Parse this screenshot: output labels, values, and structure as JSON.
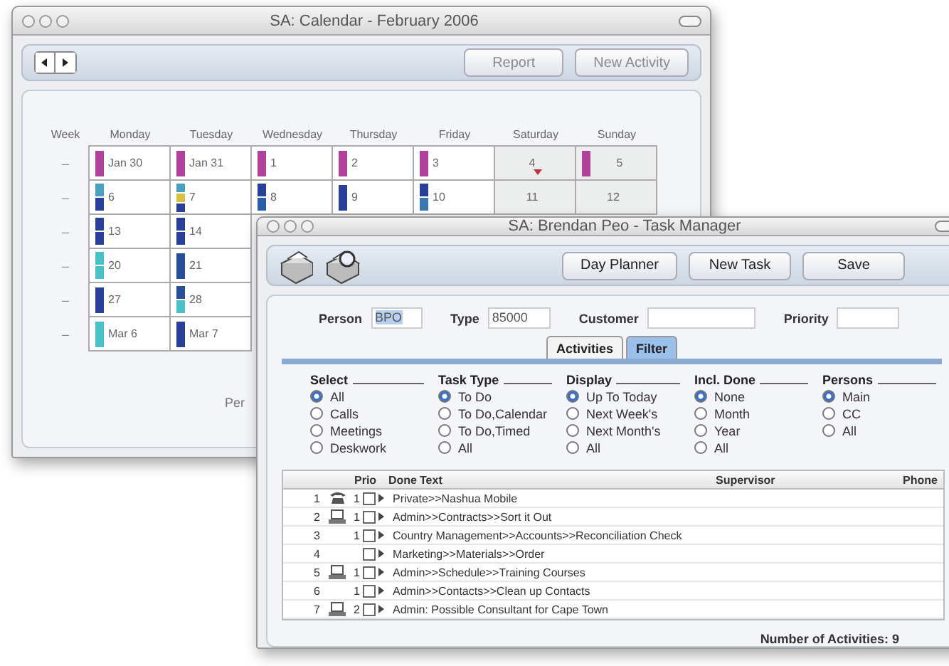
{
  "calendar": {
    "title": "SA: Calendar - February 2006",
    "buttons": [
      {
        "label": "Report",
        "disabled": true
      },
      {
        "label": "New Activity",
        "disabled": true
      }
    ],
    "week_header": "Week",
    "days": [
      {
        "label": "Monday",
        "weekend": false
      },
      {
        "label": "Tuesday",
        "weekend": false
      },
      {
        "label": "Wednesday",
        "weekend": false
      },
      {
        "label": "Thursday",
        "weekend": false
      },
      {
        "label": "Friday",
        "weekend": false
      },
      {
        "label": "Saturday",
        "weekend": true
      },
      {
        "label": "Sunday",
        "weekend": true
      }
    ],
    "weeks": [
      {
        "week": "–",
        "cells": [
          {
            "date": "Jan 30",
            "bars": [
              {
                "color": "#b0409a"
              }
            ]
          },
          {
            "date": "Jan 31",
            "bars": [
              {
                "color": "#b0409a"
              }
            ]
          },
          {
            "date": "1",
            "bars": [
              {
                "color": "#b0409a"
              }
            ]
          },
          {
            "date": "2",
            "bars": [
              {
                "color": "#b0409a"
              }
            ]
          },
          {
            "date": "3",
            "bars": [
              {
                "color": "#b0409a"
              }
            ]
          },
          {
            "date": "4",
            "marker": true
          },
          {
            "date": "5",
            "bars": [
              {
                "color": "#b0409a"
              }
            ]
          }
        ]
      },
      {
        "week": "–",
        "cells": [
          {
            "date": "6",
            "bars": [
              {
                "color": "#4aa0c0"
              },
              {
                "color": "#2a3f9a"
              }
            ]
          },
          {
            "date": "7",
            "bars": [
              {
                "color": "#4aa0c0"
              },
              {
                "color": "#d8c040"
              },
              {
                "color": "#2a3f9a"
              }
            ]
          },
          {
            "date": "8",
            "bars": [
              {
                "color": "#2a3f9a"
              },
              {
                "color": "#2a5fa8"
              }
            ]
          },
          {
            "date": "9",
            "bars": [
              {
                "color": "#2a3f9a"
              }
            ]
          },
          {
            "date": "10",
            "bars": [
              {
                "color": "#2a3f9a"
              },
              {
                "color": "#3a78b0"
              }
            ]
          },
          {
            "date": "11"
          },
          {
            "date": "12"
          }
        ]
      },
      {
        "week": "–",
        "cells": [
          {
            "date": "13",
            "bars": [
              {
                "color": "#2a3f9a"
              },
              {
                "color": "#2a3f9a"
              }
            ]
          },
          {
            "date": "14",
            "bars": [
              {
                "color": "#2a3f9a"
              },
              {
                "color": "#2a3f9a"
              }
            ]
          }
        ]
      },
      {
        "week": "–",
        "cells": [
          {
            "date": "20",
            "bars": [
              {
                "color": "#48c0c8"
              },
              {
                "color": "#48c0c8"
              }
            ]
          },
          {
            "date": "21",
            "bars": [
              {
                "color": "#2a4f9a"
              }
            ]
          }
        ]
      },
      {
        "week": "–",
        "cells": [
          {
            "date": "27",
            "bars": [
              {
                "color": "#2a3f9a"
              }
            ]
          },
          {
            "date": "28",
            "bars": [
              {
                "color": "#2a4f9a"
              },
              {
                "color": "#48c0c8"
              }
            ]
          }
        ]
      },
      {
        "week": "–",
        "cells": [
          {
            "date": "Mar 6",
            "bars": [
              {
                "color": "#48c0c8"
              }
            ]
          },
          {
            "date": "Mar 7",
            "bars": [
              {
                "color": "#2a3f9a"
              }
            ]
          }
        ]
      }
    ],
    "footer_text": "Per"
  },
  "task_manager": {
    "title": "SA: Brendan Peo - Task Manager",
    "buttons": [
      "Day Planner",
      "New Task",
      "Save"
    ],
    "fields": [
      {
        "label": "Person",
        "value": "BPO",
        "highlighted": true
      },
      {
        "label": "Type",
        "value": "85000",
        "highlighted": false
      },
      {
        "label": "Customer"
      },
      {
        "label": "Priority"
      }
    ],
    "tabs": [
      {
        "label": "Activities",
        "selected": false
      },
      {
        "label": "Filter",
        "selected": true
      }
    ],
    "filter_groups": [
      {
        "title": "Select",
        "options": [
          {
            "label": "All",
            "selected": true
          },
          {
            "label": "Calls",
            "selected": false
          },
          {
            "label": "Meetings",
            "selected": false
          },
          {
            "label": "Deskwork",
            "selected": false
          }
        ]
      },
      {
        "title": "Task Type",
        "options": [
          {
            "label": "To Do",
            "selected": true
          },
          {
            "label": "To Do,Calendar",
            "selected": false
          },
          {
            "label": "To Do,Timed",
            "selected": false
          },
          {
            "label": "All",
            "selected": false
          }
        ]
      },
      {
        "title": "Display",
        "options": [
          {
            "label": "Up To Today",
            "selected": true
          },
          {
            "label": "Next Week's",
            "selected": false
          },
          {
            "label": "Next Month's",
            "selected": false
          },
          {
            "label": "All",
            "selected": false
          }
        ]
      },
      {
        "title": "Incl. Done",
        "options": [
          {
            "label": "None",
            "selected": true
          },
          {
            "label": "Month",
            "selected": false
          },
          {
            "label": "Year",
            "selected": false
          },
          {
            "label": "All",
            "selected": false
          }
        ]
      },
      {
        "title": "Persons",
        "options": [
          {
            "label": "Main",
            "selected": true
          },
          {
            "label": "CC",
            "selected": false
          },
          {
            "label": "All",
            "selected": false
          }
        ]
      }
    ],
    "table": {
      "columns": [
        "Prio",
        "Done",
        "Text",
        "Supervisor",
        "Phone"
      ],
      "rows": [
        {
          "number": "1",
          "kind": "phone",
          "prio": "1",
          "done": false,
          "text": "Private>>Nashua Mobile"
        },
        {
          "number": "2",
          "kind": "computer",
          "prio": "1",
          "done": false,
          "text": "Admin>>Contracts>>Sort it Out"
        },
        {
          "number": "3",
          "kind": "none",
          "prio": "1",
          "done": false,
          "text": "Country Management>>Accounts>>Reconciliation Check"
        },
        {
          "number": "4",
          "kind": "none",
          "done": false,
          "text": "Marketing>>Materials>>Order"
        },
        {
          "number": "5",
          "kind": "computer",
          "prio": "1",
          "done": false,
          "text": "Admin>>Schedule>>Training Courses"
        },
        {
          "number": "6",
          "kind": "none",
          "prio": "1",
          "done": false,
          "text": "Admin>>Contacts>>Clean up Contacts"
        },
        {
          "number": "7",
          "kind": "computer",
          "prio": "2",
          "done": false,
          "text": "Admin:  Possible Consultant for Cape Town"
        }
      ]
    },
    "footer": "Number of Activities: 9"
  }
}
